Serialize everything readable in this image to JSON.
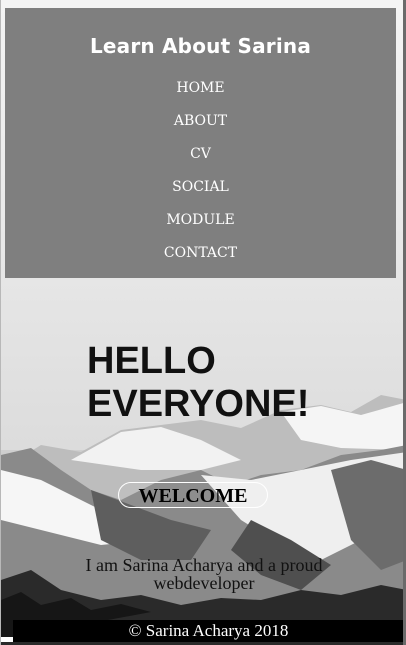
{
  "header": {
    "brand": "Learn About Sarina"
  },
  "nav": {
    "items": [
      {
        "label": "HOME"
      },
      {
        "label": "ABOUT"
      },
      {
        "label": "CV"
      },
      {
        "label": "SOCIAL"
      },
      {
        "label": "MODULE"
      },
      {
        "label": "CONTACT"
      }
    ]
  },
  "hero": {
    "title_line1": "HELLO",
    "title_line2": "EVERYONE!",
    "welcome_button": "WELCOME",
    "intro": "I am Sarina Acharya and a proud webdeveloper"
  },
  "footer": {
    "copyright": "© Sarina Acharya 2018"
  },
  "colors": {
    "navbar_bg": "#7f7f7f",
    "nav_text": "#ffffff",
    "footer_bg": "#000000"
  },
  "icons": {
    "background": "snowy-mountain-photo"
  }
}
